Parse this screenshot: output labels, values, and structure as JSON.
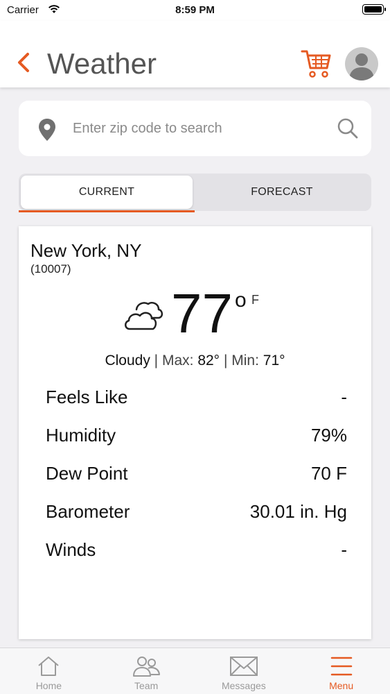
{
  "status_bar": {
    "carrier": "Carrier",
    "time": "8:59 PM"
  },
  "header": {
    "title": "Weather",
    "back_icon": "chevron-left-icon",
    "cart_icon": "cart-icon",
    "avatar_icon": "user-avatar-icon"
  },
  "search": {
    "placeholder": "Enter zip code to search",
    "value": "",
    "pin_icon": "location-pin-icon",
    "search_icon": "search-icon"
  },
  "tabs": [
    {
      "label": "CURRENT",
      "active": true
    },
    {
      "label": "FORECAST",
      "active": false
    }
  ],
  "current": {
    "city": "New York, NY",
    "zip": "(10007)",
    "temperature": "77",
    "degree_symbol": "o",
    "unit": "F",
    "condition": "Cloudy",
    "max_label": "Max:",
    "max_value": "82°",
    "min_label": "Min:",
    "min_value": "71°",
    "details": [
      {
        "label": "Feels Like",
        "value": "-"
      },
      {
        "label": "Humidity",
        "value": "79%"
      },
      {
        "label": "Dew Point",
        "value": "70 F"
      },
      {
        "label": "Barometer",
        "value": "30.01 in. Hg"
      },
      {
        "label": "Winds",
        "value": "-"
      }
    ]
  },
  "bottom_nav": [
    {
      "label": "Home",
      "icon": "home-icon",
      "active": false
    },
    {
      "label": "Team",
      "icon": "team-icon",
      "active": false
    },
    {
      "label": "Messages",
      "icon": "envelope-icon",
      "active": false
    },
    {
      "label": "Menu",
      "icon": "menu-icon",
      "active": true
    }
  ],
  "colors": {
    "accent": "#e55a22",
    "background": "#f1f0f3",
    "inactive": "#9a9a9a"
  }
}
